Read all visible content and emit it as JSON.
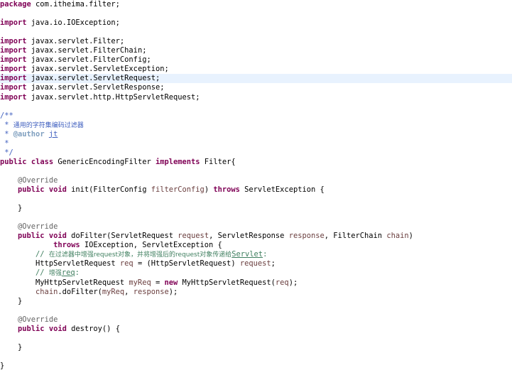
{
  "editor": {
    "lines": [
      {
        "tokens": [
          {
            "t": "package",
            "c": "kw"
          },
          {
            "t": " com.itheima.filter;"
          }
        ]
      },
      {
        "tokens": []
      },
      {
        "tokens": [
          {
            "t": "import",
            "c": "kw"
          },
          {
            "t": " java.io.IOException;"
          }
        ]
      },
      {
        "tokens": []
      },
      {
        "tokens": [
          {
            "t": "import",
            "c": "kw"
          },
          {
            "t": " javax.servlet.Filter;"
          }
        ]
      },
      {
        "tokens": [
          {
            "t": "import",
            "c": "kw"
          },
          {
            "t": " javax.servlet.FilterChain;"
          }
        ]
      },
      {
        "tokens": [
          {
            "t": "import",
            "c": "kw"
          },
          {
            "t": " javax.servlet.FilterConfig;"
          }
        ]
      },
      {
        "tokens": [
          {
            "t": "import",
            "c": "kw"
          },
          {
            "t": " javax.servlet.ServletException;"
          }
        ]
      },
      {
        "highlight": true,
        "tokens": [
          {
            "t": "import",
            "c": "kw"
          },
          {
            "t": " javax.servlet.ServletRequest;"
          }
        ]
      },
      {
        "tokens": [
          {
            "t": "import",
            "c": "kw"
          },
          {
            "t": " javax.servlet.ServletResponse;"
          }
        ]
      },
      {
        "tokens": [
          {
            "t": "import",
            "c": "kw"
          },
          {
            "t": " javax.servlet.http.HttpServletRequest;"
          }
        ]
      },
      {
        "tokens": []
      },
      {
        "tokens": [
          {
            "t": "/**",
            "c": "jd"
          }
        ]
      },
      {
        "tokens": [
          {
            "t": " * ",
            "c": "jd"
          },
          {
            "t": "通用的字符集编码过滤器",
            "c": "jd cjk"
          }
        ]
      },
      {
        "tokens": [
          {
            "t": " * ",
            "c": "jd"
          },
          {
            "t": "@author",
            "c": "tag"
          },
          {
            "t": " ",
            "c": "jd"
          },
          {
            "t": "jt",
            "c": "jd ul"
          }
        ]
      },
      {
        "tokens": [
          {
            "t": " *",
            "c": "jd"
          }
        ]
      },
      {
        "tokens": [
          {
            "t": " */",
            "c": "jd"
          }
        ]
      },
      {
        "tokens": [
          {
            "t": "public",
            "c": "kw"
          },
          {
            "t": " "
          },
          {
            "t": "class",
            "c": "kw"
          },
          {
            "t": " GenericEncodingFilter "
          },
          {
            "t": "implements",
            "c": "kw"
          },
          {
            "t": " Filter{"
          }
        ]
      },
      {
        "tokens": []
      },
      {
        "tokens": [
          {
            "t": "    "
          },
          {
            "t": "@Override",
            "c": "an"
          }
        ]
      },
      {
        "tokens": [
          {
            "t": "    "
          },
          {
            "t": "public",
            "c": "kw"
          },
          {
            "t": " "
          },
          {
            "t": "void",
            "c": "kw"
          },
          {
            "t": " init(FilterConfig "
          },
          {
            "t": "filterConfig",
            "c": "vr"
          },
          {
            "t": ") "
          },
          {
            "t": "throws",
            "c": "kw"
          },
          {
            "t": " ServletException {"
          }
        ]
      },
      {
        "tokens": []
      },
      {
        "tokens": [
          {
            "t": "    }"
          }
        ]
      },
      {
        "tokens": []
      },
      {
        "tokens": [
          {
            "t": "    "
          },
          {
            "t": "@Override",
            "c": "an"
          }
        ]
      },
      {
        "tokens": [
          {
            "t": "    "
          },
          {
            "t": "public",
            "c": "kw"
          },
          {
            "t": " "
          },
          {
            "t": "void",
            "c": "kw"
          },
          {
            "t": " doFilter(ServletRequest "
          },
          {
            "t": "request",
            "c": "vr"
          },
          {
            "t": ", ServletResponse "
          },
          {
            "t": "response",
            "c": "vr"
          },
          {
            "t": ", FilterChain "
          },
          {
            "t": "chain",
            "c": "vr"
          },
          {
            "t": ")"
          }
        ]
      },
      {
        "tokens": [
          {
            "t": "            "
          },
          {
            "t": "throws",
            "c": "kw"
          },
          {
            "t": " IOException, ServletException {"
          }
        ]
      },
      {
        "tokens": [
          {
            "t": "        "
          },
          {
            "t": "// ",
            "c": "cm"
          },
          {
            "t": "在过滤器中增强request对象，并将增强后的request对象传递给",
            "c": "cm cjk"
          },
          {
            "t": "Servlet",
            "c": "cm ul"
          },
          {
            "t": ":",
            "c": "cm"
          }
        ]
      },
      {
        "tokens": [
          {
            "t": "        HttpServletRequest "
          },
          {
            "t": "req",
            "c": "vr"
          },
          {
            "t": " = (HttpServletRequest) "
          },
          {
            "t": "request",
            "c": "vr"
          },
          {
            "t": ";"
          }
        ]
      },
      {
        "tokens": [
          {
            "t": "        "
          },
          {
            "t": "// ",
            "c": "cm"
          },
          {
            "t": "增强",
            "c": "cm cjk"
          },
          {
            "t": "req",
            "c": "cm ul"
          },
          {
            "t": ":",
            "c": "cm"
          }
        ]
      },
      {
        "tokens": [
          {
            "t": "        MyHttpServletRequest "
          },
          {
            "t": "myReq",
            "c": "vr"
          },
          {
            "t": " = "
          },
          {
            "t": "new",
            "c": "kw"
          },
          {
            "t": " MyHttpServletRequest("
          },
          {
            "t": "req",
            "c": "vr"
          },
          {
            "t": ");"
          }
        ]
      },
      {
        "tokens": [
          {
            "t": "        "
          },
          {
            "t": "chain",
            "c": "vr"
          },
          {
            "t": ".doFilter("
          },
          {
            "t": "myReq",
            "c": "vr"
          },
          {
            "t": ", "
          },
          {
            "t": "response",
            "c": "vr"
          },
          {
            "t": ");"
          }
        ]
      },
      {
        "tokens": [
          {
            "t": "    }"
          }
        ]
      },
      {
        "tokens": []
      },
      {
        "tokens": [
          {
            "t": "    "
          },
          {
            "t": "@Override",
            "c": "an"
          }
        ]
      },
      {
        "tokens": [
          {
            "t": "    "
          },
          {
            "t": "public",
            "c": "kw"
          },
          {
            "t": " "
          },
          {
            "t": "void",
            "c": "kw"
          },
          {
            "t": " destroy() {"
          }
        ]
      },
      {
        "tokens": []
      },
      {
        "tokens": [
          {
            "t": "    }"
          }
        ]
      },
      {
        "tokens": []
      },
      {
        "tokens": [
          {
            "t": "}"
          }
        ]
      }
    ]
  }
}
